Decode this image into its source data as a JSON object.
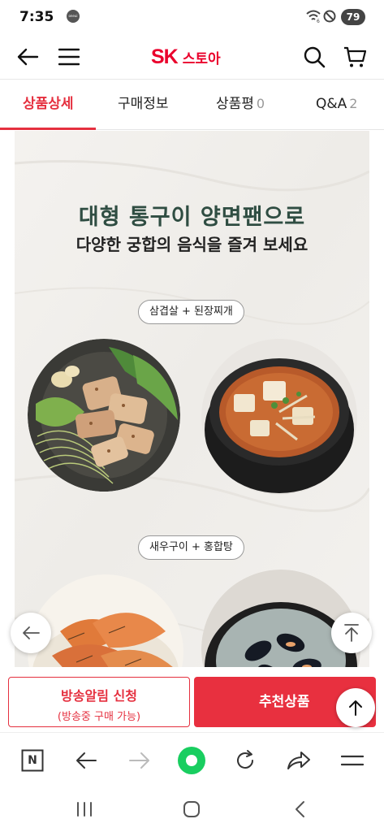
{
  "status_bar": {
    "time": "7:35",
    "notification_badge": "oneui eats",
    "battery": "79"
  },
  "header": {
    "logo_sk": "SK",
    "logo_store": "스토아",
    "brand_color": "#ea002c"
  },
  "tabs": [
    {
      "label": "상품상세",
      "count": "",
      "active": true
    },
    {
      "label": "구매정보",
      "count": "",
      "active": false
    },
    {
      "label": "상품평",
      "count": "0",
      "active": false
    },
    {
      "label": "Q&A",
      "count": "2",
      "active": false
    }
  ],
  "content": {
    "headline": "대형 통구이 양면팬으로",
    "subheadline": "다양한 궁합의 음식을 즐겨 보세요",
    "pairing_1": "삼겹살 + 된장찌개",
    "pairing_2": "새우구이 + 홍합탕"
  },
  "actions": {
    "alarm_main": "방송알림 신청",
    "alarm_sub": "(방송중 구매 가능)",
    "recommend": "추천상품"
  },
  "browser_bar": {
    "n_label": "N"
  },
  "colors": {
    "accent": "#e5303f",
    "headline": "#2f4d42",
    "content_bg": "#f2f0ed"
  }
}
